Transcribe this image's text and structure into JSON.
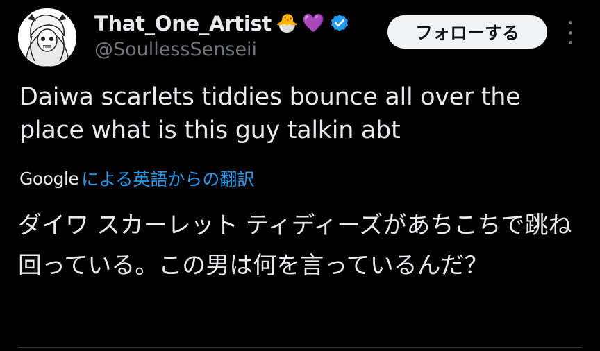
{
  "user": {
    "display_name": "That_One_Artist",
    "emoji_1": "🐣",
    "emoji_2": "💜",
    "handle": "@SoullessSenseii",
    "verified_color": "#1d9bf0"
  },
  "actions": {
    "follow_label": "フォローする"
  },
  "tweet": {
    "text": "Daiwa scarlets tiddies bounce all over the place what is this guy talkin abt"
  },
  "translation": {
    "provider": "Google",
    "link_text": "による英語からの翻訳",
    "text": "ダイワ スカーレット ティディーズがあちこちで跳ね回っている。この男は何を言っているんだ？"
  },
  "colors": {
    "background": "#000000",
    "text": "#e7e9ea",
    "secondary": "#71767b",
    "accent": "#1d9bf0"
  }
}
